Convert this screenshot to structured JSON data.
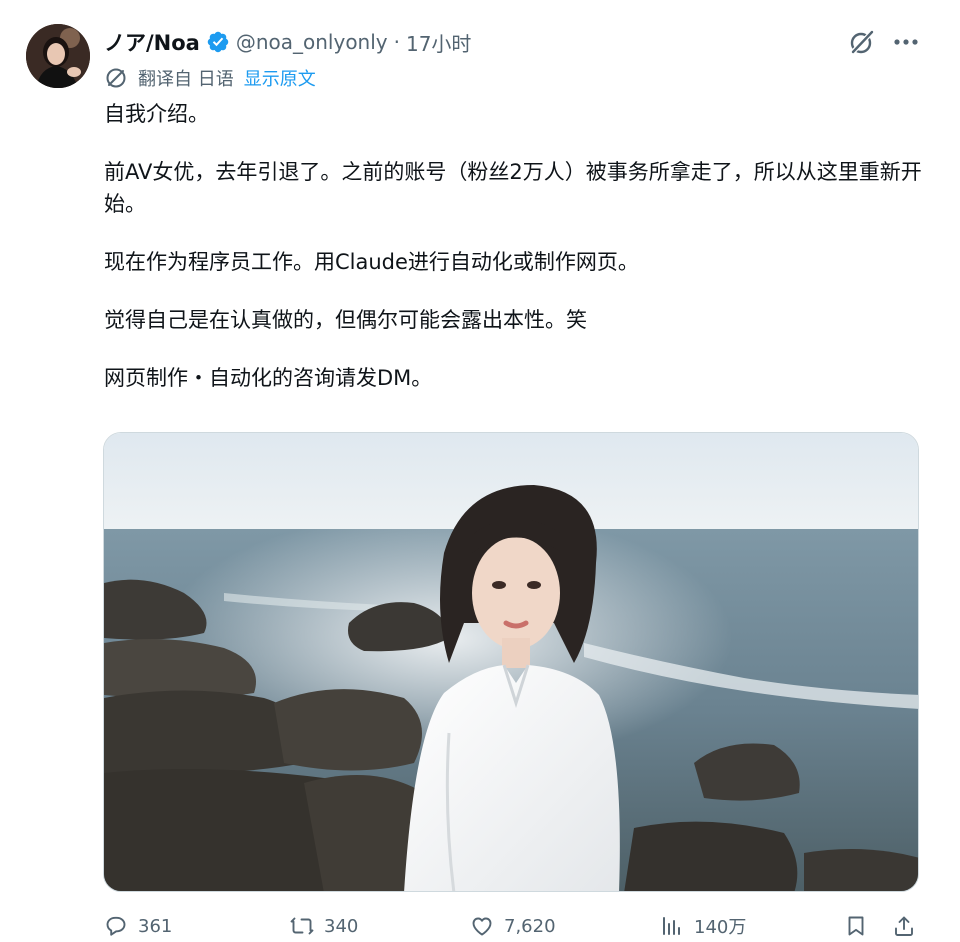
{
  "author": {
    "display_name": "ノア/Noa",
    "handle": "@noa_onlyonly",
    "separator": "·",
    "time": "17小时",
    "verified_color": "#1d9bf0"
  },
  "translation": {
    "label": "翻译自 日语",
    "show_original": "显示原文"
  },
  "body": {
    "p1": "自我介绍。",
    "p2": "前AV女优，去年引退了。之前的账号（粉丝2万人）被事务所拿走了，所以从这里重新开始。",
    "p3": "现在作为程序员工作。用Claude进行自动化或制作网页。",
    "p4": "觉得自己是在认真做的，但偶尔可能会露出本性。笑",
    "p5": "网页制作・自动化的咨询请发DM。"
  },
  "actions": {
    "replies": "361",
    "retweets": "340",
    "likes": "7,620",
    "views": "140万"
  },
  "icons": {
    "grok": "grok-slash-circle-icon",
    "more": "more-dots-icon",
    "translate": "translate-icon",
    "reply": "reply-bubble-icon",
    "retweet": "retweet-arrows-icon",
    "like": "heart-icon",
    "views": "bar-chart-icon",
    "bookmark": "bookmark-icon",
    "share": "share-upload-icon"
  },
  "colors": {
    "text_primary": "#0f1419",
    "text_secondary": "#536471",
    "accent": "#1d9bf0"
  }
}
